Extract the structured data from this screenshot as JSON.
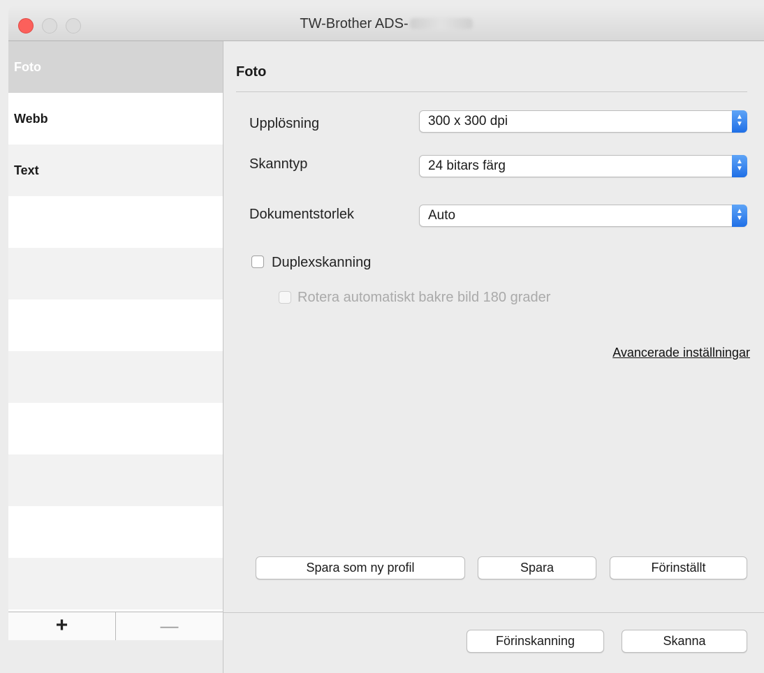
{
  "window": {
    "title": "TW-Brother ADS-"
  },
  "sidebar": {
    "items": [
      {
        "label": "Foto"
      },
      {
        "label": "Webb"
      },
      {
        "label": "Text"
      }
    ],
    "add_label": "+",
    "remove_label": "—"
  },
  "main": {
    "section_title": "Foto",
    "fields": [
      {
        "label": "Upplösning",
        "value": "300 x 300 dpi"
      },
      {
        "label": "Skanntyp",
        "value": "24 bitars färg"
      },
      {
        "label": "Dokumentstorlek",
        "value": "Auto"
      }
    ],
    "duplex_label": "Duplexskanning",
    "rotate_label": "Rotera automatiskt bakre bild 180 grader",
    "advanced_link": "Avancerade inställningar",
    "buttons": {
      "save_new": "Spara som ny profil",
      "save": "Spara",
      "default": "Förinställt"
    },
    "footer": {
      "prescan": "Förinskanning",
      "scan": "Skanna"
    }
  },
  "colors": {
    "accent": "#2f80ed",
    "close": "#fc605b",
    "selection": "#d5d5d5"
  }
}
